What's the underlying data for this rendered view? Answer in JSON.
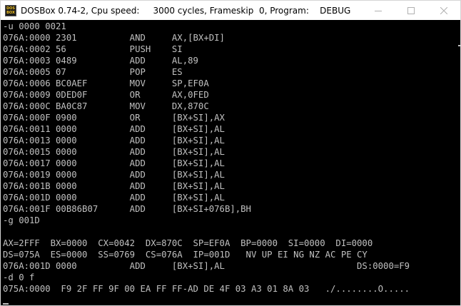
{
  "window": {
    "title": "DOSBox 0.74-2, Cpu speed:     3000 cycles, Frameskip  0, Program:    DEBUG",
    "icon_text": [
      "DOS",
      "BOX"
    ],
    "icons": {
      "app": "dosbox-icon",
      "minimize": "minimize-icon",
      "maximize": "maximize-icon",
      "close": "close-icon"
    }
  },
  "terminal": {
    "lines": [
      "-u 0000 0021",
      "076A:0000 2301          AND     AX,[BX+DI]",
      "076A:0002 56            PUSH    SI",
      "076A:0003 0489          ADD     AL,89",
      "076A:0005 07            POP     ES",
      "076A:0006 BC0AEF        MOV     SP,EF0A",
      "076A:0009 0DED0F        OR      AX,0FED",
      "076A:000C BA0C87        MOV     DX,870C",
      "076A:000F 0900          OR      [BX+SI],AX",
      "076A:0011 0000          ADD     [BX+SI],AL",
      "076A:0013 0000          ADD     [BX+SI],AL",
      "076A:0015 0000          ADD     [BX+SI],AL",
      "076A:0017 0000          ADD     [BX+SI],AL",
      "076A:0019 0000          ADD     [BX+SI],AL",
      "076A:001B 0000          ADD     [BX+SI],AL",
      "076A:001D 0000          ADD     [BX+SI],AL",
      "076A:001F 00B86B07      ADD     [BX+SI+076B],BH",
      "-g 001D",
      "",
      "AX=2FFF  BX=0000  CX=0042  DX=870C  SP=EF0A  BP=0000  SI=0000  DI=0000",
      "DS=075A  ES=0000  SS=0769  CS=076A  IP=001D   NV UP EI NG NZ AC PE CY",
      "076A:001D 0000          ADD     [BX+SI],AL                         DS:0000=F9",
      "-d 0 f",
      "075A:0000  F9 2F FF 9F 00 EA FF FF-AD DE 4F 03 A3 01 8A 03   ./........O....."
    ]
  },
  "colors": {
    "screen_bg": "#000000",
    "text": "#c0c0c0",
    "titlebar_bg": "#ffffff",
    "title_text": "#000000",
    "controls": "#b0b0b0"
  }
}
